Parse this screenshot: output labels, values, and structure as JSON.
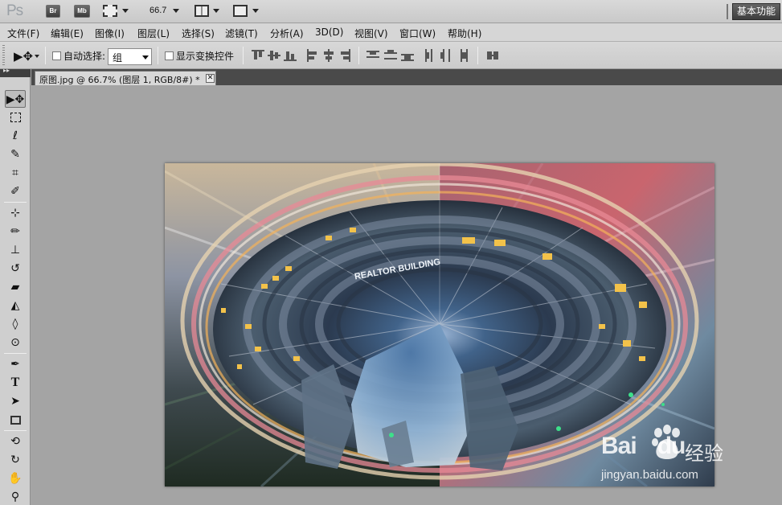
{
  "app": {
    "logo": "Ps",
    "br_label": "Br",
    "mb_label": "Mb",
    "zoom": "66.7",
    "workspace": "基本功能"
  },
  "menu": [
    "文件(F)",
    "编辑(E)",
    "图像(I)",
    "图层(L)",
    "选择(S)",
    "滤镜(T)",
    "分析(A)",
    "3D(D)",
    "视图(V)",
    "窗口(W)",
    "帮助(H)"
  ],
  "options": {
    "auto_select_label": "自动选择:",
    "auto_select_value": "组",
    "show_transform_label": "显示变换控件"
  },
  "document": {
    "tab_title": "原图.jpg @ 66.7% (图层 1, RGB/8#) *"
  },
  "tools": [
    "move-tool",
    "marquee-tool",
    "lasso-tool",
    "quick-selection-tool",
    "crop-tool",
    "eyedropper-tool",
    "spot-healing-tool",
    "brush-tool",
    "clone-stamp-tool",
    "history-brush-tool",
    "eraser-tool",
    "paint-bucket-tool",
    "blur-tool",
    "dodge-tool",
    "pen-tool",
    "type-tool",
    "path-selection-tool",
    "rectangle-tool",
    "3d-rotate-tool",
    "3d-orbit-tool",
    "hand-tool",
    "zoom-tool"
  ],
  "artwork": {
    "banner_text": "REALTOR BUILDING"
  },
  "watermark": {
    "brand_latin": "Bai",
    "brand_latin2": "du",
    "brand_cn": "经验",
    "url": "jingyan.baidu.com"
  },
  "colors": {
    "workspace_bg": "#a4a4a4",
    "panel_bg": "#cfcfcf"
  }
}
